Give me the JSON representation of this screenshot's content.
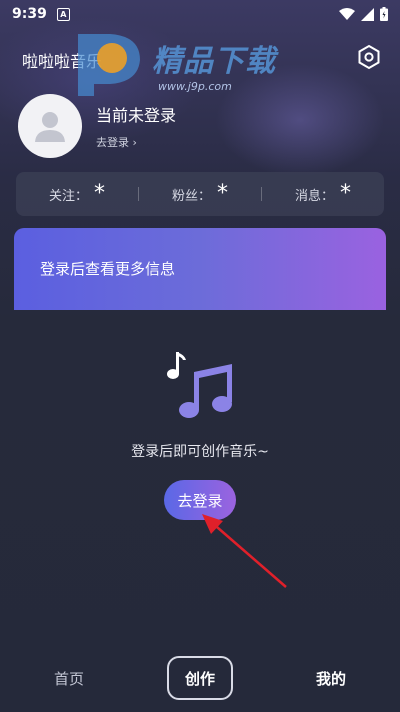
{
  "status_bar": {
    "time": "9:39",
    "notification_icon": "A"
  },
  "header": {
    "app_title": "啦啦啦音乐"
  },
  "watermark": {
    "logo_text": "精品下载",
    "url": "www.j9p.com"
  },
  "profile": {
    "name": "当前未登录",
    "login_link": "去登录 ›"
  },
  "stats": [
    {
      "label": "关注：",
      "value": "*"
    },
    {
      "label": "粉丝：",
      "value": "*"
    },
    {
      "label": "消息：",
      "value": "*"
    }
  ],
  "promo": {
    "text": "登录后查看更多信息"
  },
  "empty_state": {
    "message": "登录后即可创作音乐~",
    "button_label": "去登录"
  },
  "bottom_nav": [
    {
      "label": "首页"
    },
    {
      "label": "创作"
    },
    {
      "label": "我的"
    }
  ],
  "colors": {
    "accent_start": "#5a68e6",
    "accent_end": "#9b63df",
    "arrow": "#e0202a"
  }
}
